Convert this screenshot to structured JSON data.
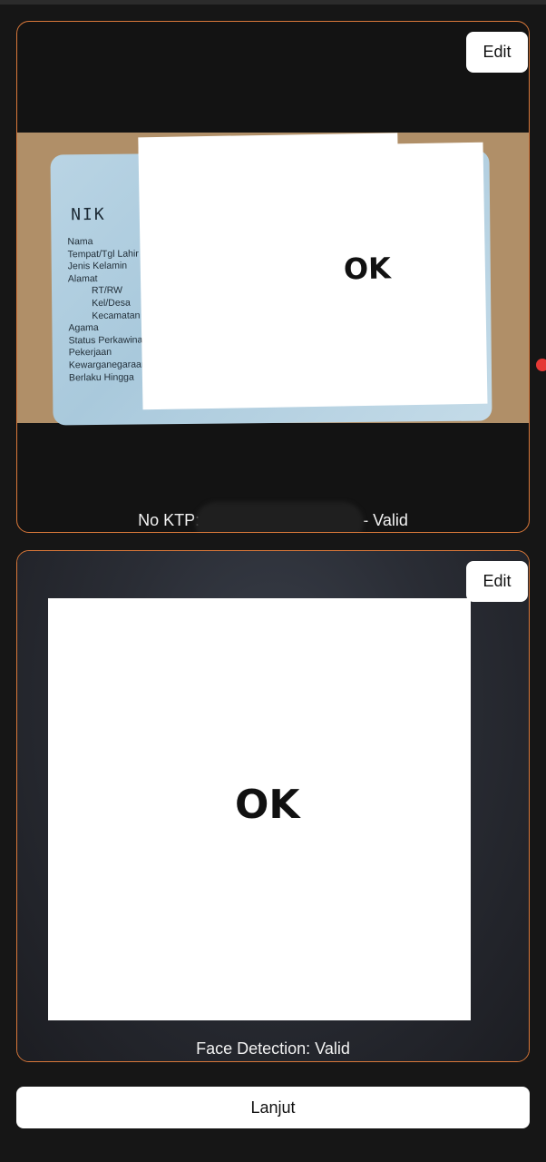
{
  "ktp_card": {
    "edit_label": "Edit",
    "nik_label": "NIK",
    "fields": [
      "Nama",
      "Tempat/Tgl Lahir",
      "Jenis Kelamin",
      "Alamat",
      "RT/RW",
      "Kel/Desa",
      "Kecamatan",
      "Agama",
      "Status Perkawinan",
      "Pekerjaan",
      "Kewarganegaraan",
      "Berlaku Hingga"
    ],
    "redaction_text": "OK",
    "caption_prefix": "No KTP:",
    "caption_suffix": "- Valid"
  },
  "face_card": {
    "edit_label": "Edit",
    "redaction_text": "OK",
    "caption": "Face Detection: Valid"
  },
  "footer": {
    "continue_label": "Lanjut"
  },
  "colors": {
    "background": "#161616",
    "card_border": "#d9783a",
    "button_bg": "#ffffff",
    "indicator": "#e53935"
  }
}
